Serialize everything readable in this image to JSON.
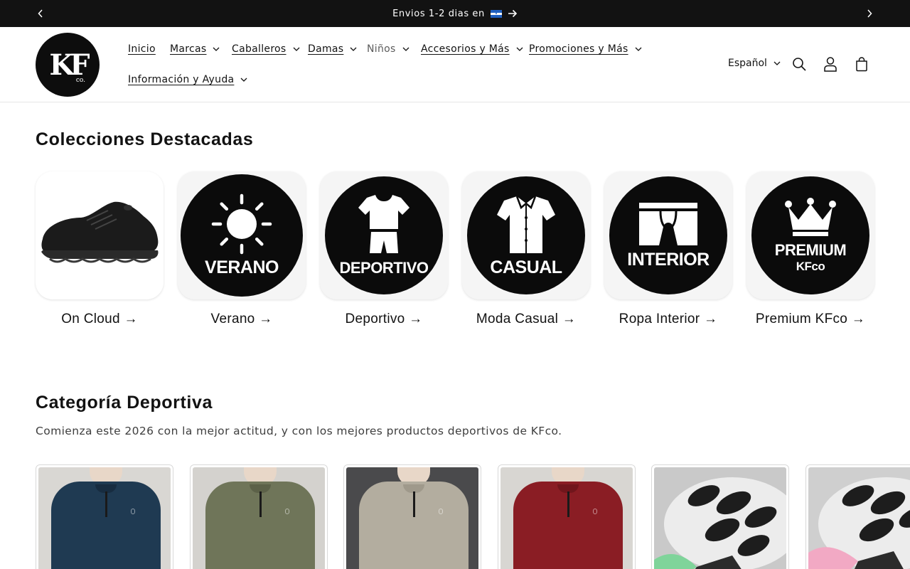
{
  "announcement": {
    "text": "Envios 1-2 dias en",
    "flag_icon": "honduras-flag-icon",
    "background": "#121212"
  },
  "header": {
    "logo_text": "KF",
    "logo_suffix": "co.",
    "nav": [
      {
        "label": "Inicio",
        "has_dropdown": false
      },
      {
        "label": "Marcas",
        "has_dropdown": true
      },
      {
        "label": "Caballeros",
        "has_dropdown": true
      },
      {
        "label": "Damas",
        "has_dropdown": true
      },
      {
        "label": "Niños",
        "has_dropdown": true
      },
      {
        "label": "Accesorios y Más",
        "has_dropdown": true
      },
      {
        "label": "Promociones y Más",
        "has_dropdown": true
      },
      {
        "label": "Información y Ayuda",
        "has_dropdown": true
      }
    ],
    "language": "Español",
    "icons": [
      "search-icon",
      "account-icon",
      "cart-icon"
    ]
  },
  "featured": {
    "title": "Colecciones Destacadas",
    "collections": [
      {
        "label": "On Cloud",
        "image_text": ""
      },
      {
        "label": "Verano",
        "image_text": "VERANO"
      },
      {
        "label": "Deportivo",
        "image_text": "DEPORTIVO"
      },
      {
        "label": "Moda Casual",
        "image_text": "CASUAL"
      },
      {
        "label": "Ropa Interior",
        "image_text": "INTERIOR"
      },
      {
        "label": "Premium KFco",
        "image_text": "PREMIUM",
        "image_subtext": "KFco"
      }
    ]
  },
  "category": {
    "title": "Categoría Deportiva",
    "subtitle": "Comienza este 2026 con la mejor actitud, y con los mejores productos deportivos de KFco.",
    "products": [
      {
        "kind": "shirt",
        "color": "#1f3a52"
      },
      {
        "kind": "shirt",
        "color": "#6f7559"
      },
      {
        "kind": "shirt",
        "color": "#b3ad9f"
      },
      {
        "kind": "shirt",
        "color": "#8a1d24"
      },
      {
        "kind": "shoe",
        "color": "#7fd49a"
      },
      {
        "kind": "shoe",
        "color": "#f2a9c4"
      }
    ]
  }
}
